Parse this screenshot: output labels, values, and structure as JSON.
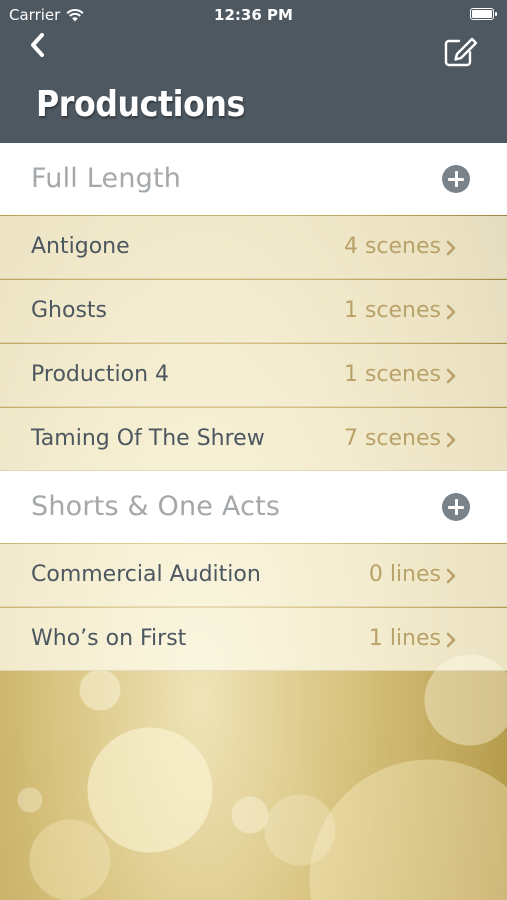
{
  "status_bar": {
    "carrier": "Carrier",
    "time": "12:36 PM"
  },
  "nav": {
    "title": "Productions",
    "back_icon": "chevron-left-icon",
    "edit_icon": "compose-icon"
  },
  "sections": [
    {
      "title": "Full Length",
      "rows": [
        {
          "name": "Antigone",
          "count": "4 scenes"
        },
        {
          "name": "Ghosts",
          "count": "1 scenes"
        },
        {
          "name": "Production 4",
          "count": "1 scenes"
        },
        {
          "name": "Taming Of The Shrew",
          "count": "7 scenes"
        }
      ]
    },
    {
      "title": "Shorts & One Acts",
      "rows": [
        {
          "name": "Commercial Audition",
          "count": "0 lines"
        },
        {
          "name": "Who’s on First",
          "count": "1 lines"
        }
      ]
    }
  ],
  "colors": {
    "header_bg": "#4d5861",
    "section_label": "#a4a8ab",
    "row_name": "#4d5760",
    "row_count": "#b9a26a",
    "add_button": "#7a838a"
  }
}
